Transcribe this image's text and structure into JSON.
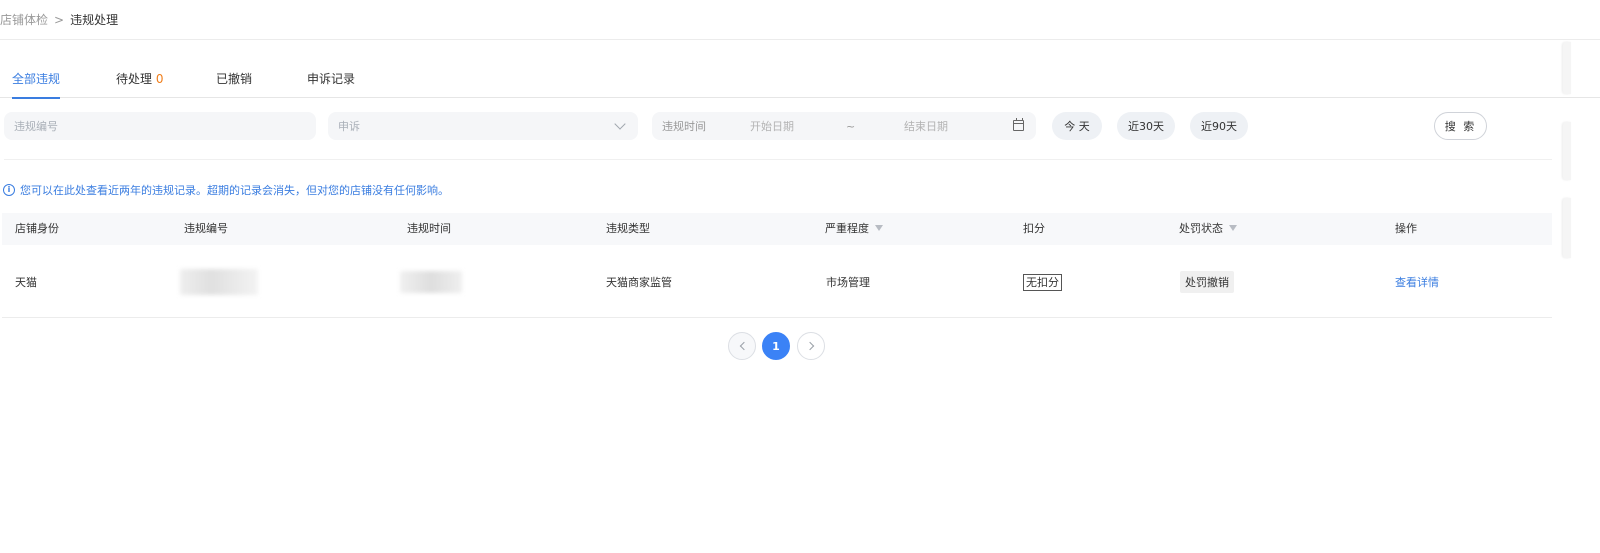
{
  "breadcrumb": {
    "parent": "店铺体检",
    "separator": ">",
    "current": "违规处理"
  },
  "tabs": [
    {
      "label": "全部违规",
      "active": true
    },
    {
      "label": "待处理",
      "count": "0"
    },
    {
      "label": "已撤销"
    },
    {
      "label": "申诉记录"
    }
  ],
  "filters": {
    "violation_id_placeholder": "违规编号",
    "appeal_select_value": "申诉",
    "date_label": "违规时间",
    "start_placeholder": "开始日期",
    "range_separator": "~",
    "end_placeholder": "结束日期",
    "quick": [
      "今 天",
      "近30天",
      "近90天"
    ],
    "search_label": "搜 索"
  },
  "notice": {
    "icon": "info-icon",
    "text": "您可以在此处查看近两年的违规记录。超期的记录会消失，但对您的店铺没有任何影响。"
  },
  "table": {
    "columns": [
      "店铺身份",
      "违规编号",
      "违规时间",
      "违规类型",
      "严重程度",
      "扣分",
      "处罚状态",
      "操作"
    ],
    "rows": [
      {
        "shop_identity": "天猫",
        "violation_type": "天猫商家监管",
        "severity": "市场管理",
        "deduction": "无扣分",
        "status": "处罚撤销",
        "action": "查看详情"
      }
    ]
  },
  "pagination": {
    "current_page": "1"
  },
  "colors": {
    "accent": "#3a7de0",
    "pending_count": "#f07d19",
    "page_active": "#3b82f6"
  }
}
